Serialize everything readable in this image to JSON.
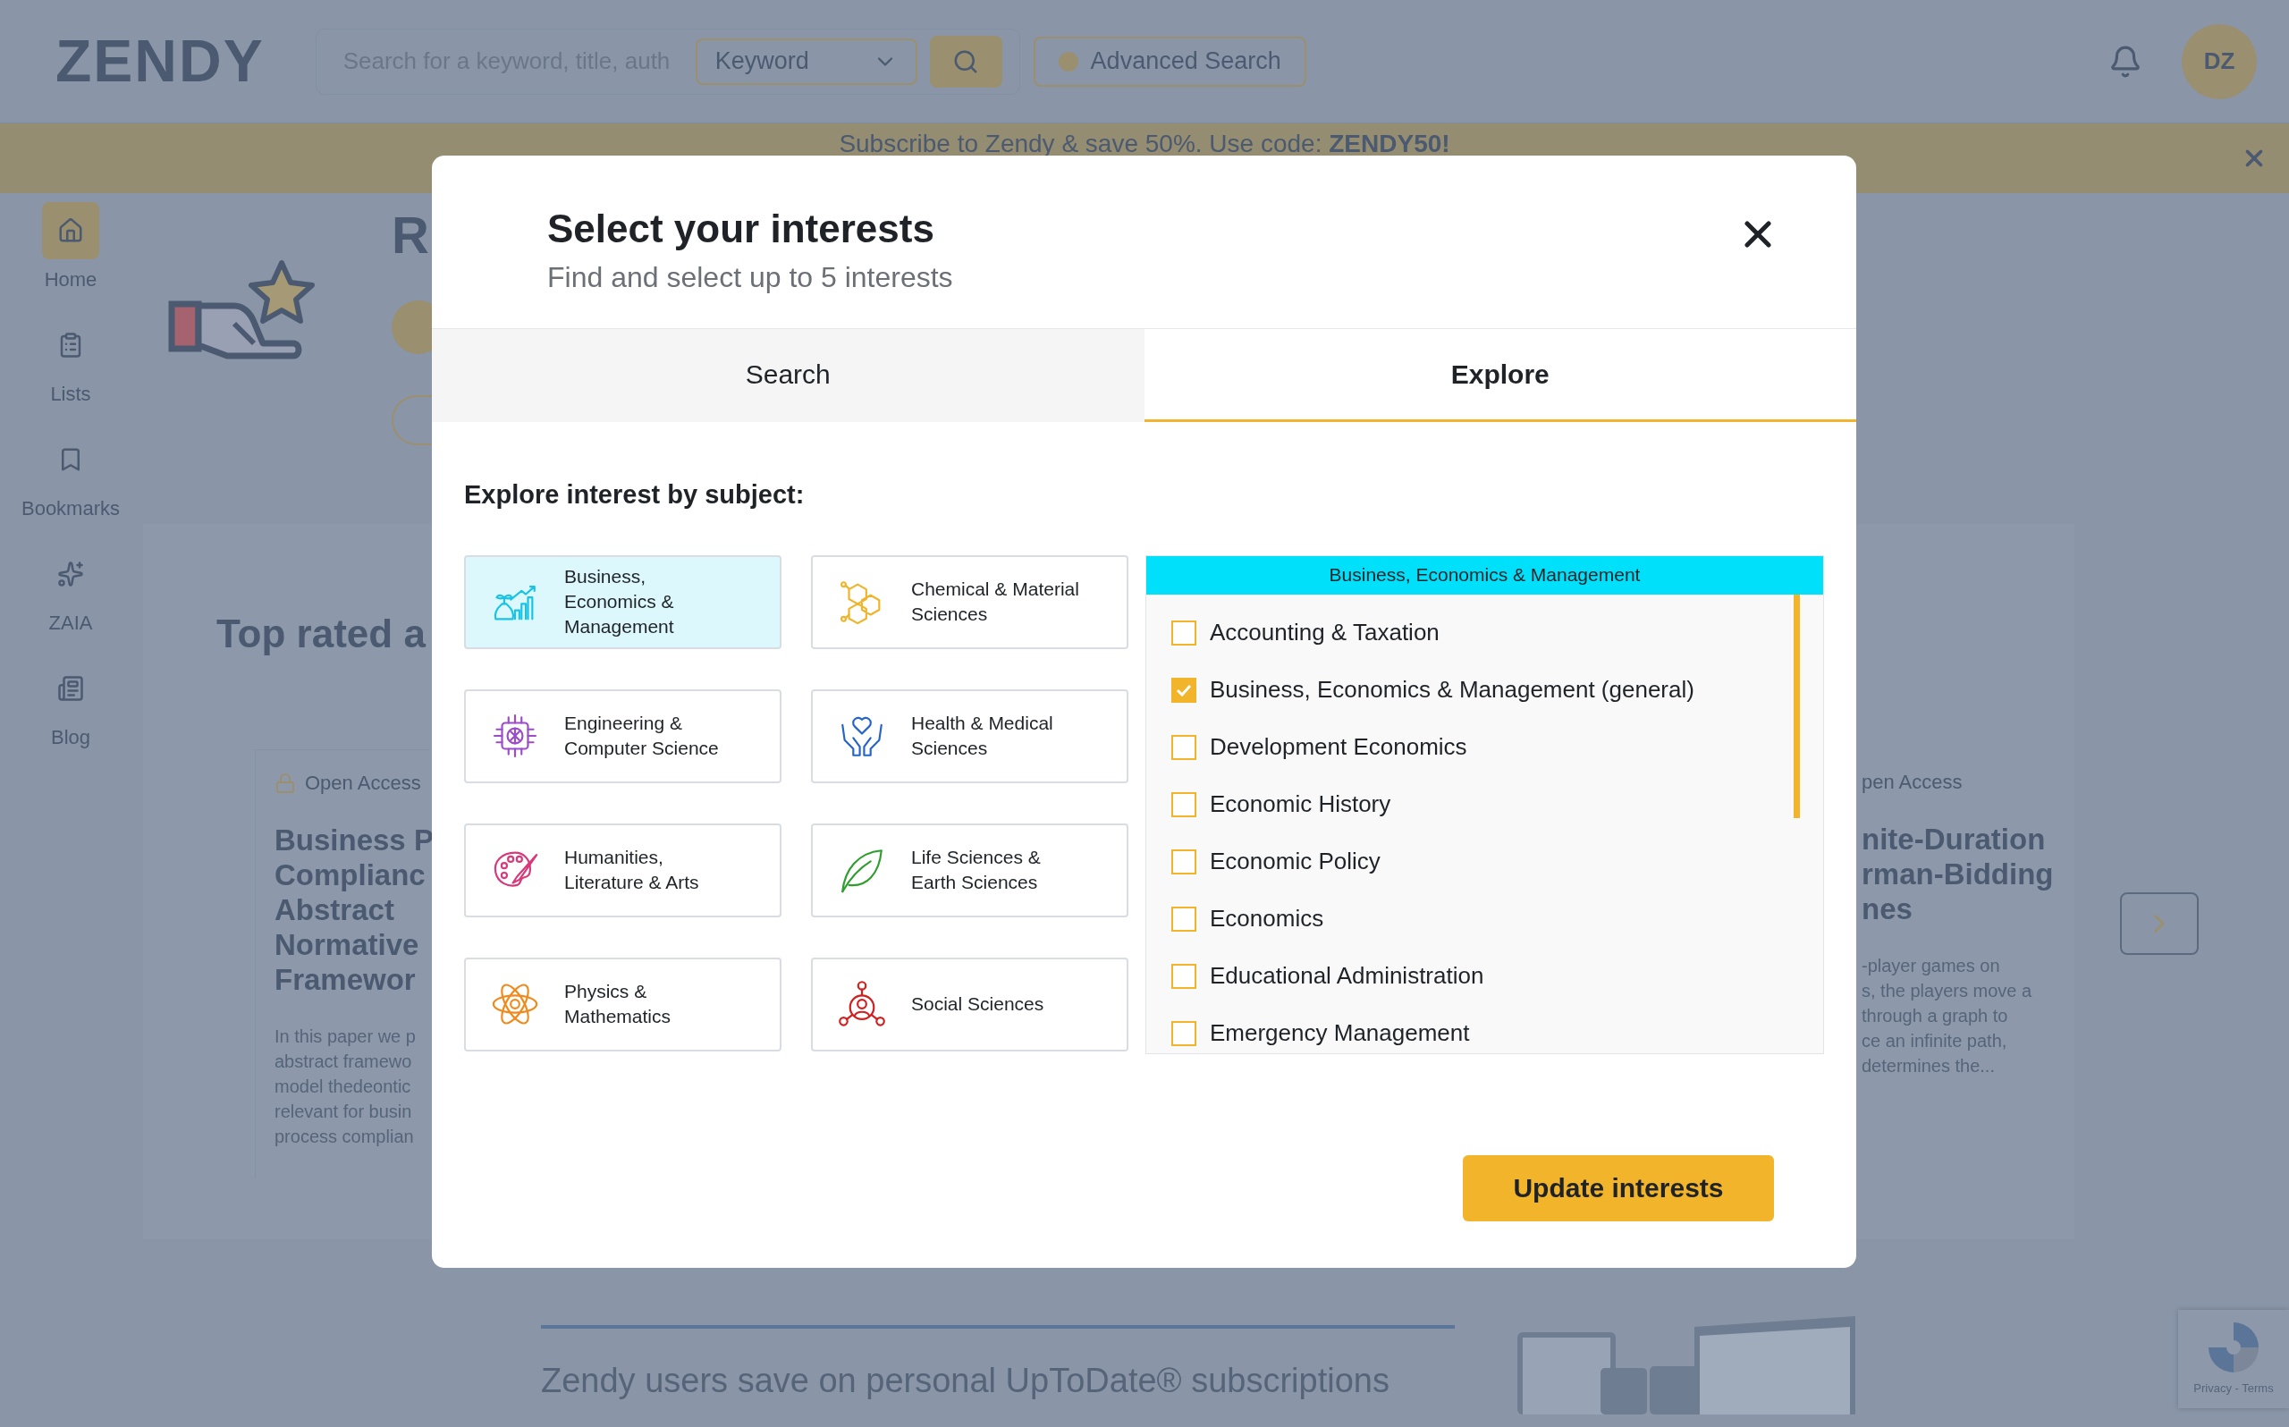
{
  "header": {
    "logo": "ZENDY",
    "search": {
      "placeholder": "Search for a keyword, title, auth"
    },
    "search_type": "Keyword",
    "advanced_search": "Advanced Search",
    "avatar": "DZ"
  },
  "banner": {
    "text": "Subscribe to Zendy & save 50%. Use code: **ZENDY50!**"
  },
  "sidebar": [
    {
      "label": "Home",
      "selected": true
    },
    {
      "label": "Lists",
      "selected": false
    },
    {
      "label": "Bookmarks",
      "selected": false
    },
    {
      "label": "ZAIA",
      "selected": false
    },
    {
      "label": "Blog",
      "selected": false
    }
  ],
  "page": {
    "heading": "R",
    "section_title": "Top rated a",
    "cards": [
      {
        "badge": "Open Access",
        "title_lines": [
          "Business P",
          "Complianc",
          "Abstract",
          "Normative",
          "Framewor"
        ],
        "abstract_lines": [
          "In this paper we p",
          "abstract framewo",
          "model thedeontic",
          "relevant for busin",
          "process complian"
        ]
      },
      {
        "badge": "pen Access",
        "title_lines": [
          "nite-Duration",
          "rman-Bidding",
          "nes"
        ],
        "abstract_lines": [
          "-player games on",
          "s, the players move a",
          "through a graph to",
          "ce an infinite path,",
          "determines the..."
        ]
      }
    ]
  },
  "promo": {
    "text": "Zendy users save on personal UpToDate® subscriptions"
  },
  "recaptcha": {
    "links": "Privacy - Terms"
  },
  "modal": {
    "title": "Select your interests",
    "subtitle": "Find and select up to 5 interests",
    "tabs": [
      {
        "label": "Search",
        "selected": false
      },
      {
        "label": "Explore",
        "selected": true
      }
    ],
    "prompt": "Explore interest by subject:",
    "subjects": [
      {
        "label_lines": [
          "Business,",
          "Economics &",
          "Management"
        ],
        "selected": true
      },
      {
        "label_lines": [
          "Chemical & Material",
          "Sciences"
        ],
        "selected": false
      },
      {
        "label_lines": [
          "Engineering &",
          "Computer Science"
        ],
        "selected": false
      },
      {
        "label_lines": [
          "Health & Medical",
          "Sciences"
        ],
        "selected": false
      },
      {
        "label_lines": [
          "Humanities,",
          "Literature & Arts"
        ],
        "selected": false
      },
      {
        "label_lines": [
          "Life Sciences &",
          "Earth Sciences"
        ],
        "selected": false
      },
      {
        "label_lines": [
          "Physics &",
          "Mathematics"
        ],
        "selected": false
      },
      {
        "label_lines": [
          "Social Sciences"
        ],
        "selected": false
      }
    ],
    "subject_panel": {
      "title": "Business, Economics & Management",
      "options": [
        {
          "label": "Accounting & Taxation",
          "checked": false
        },
        {
          "label": "Business, Economics & Management (general)",
          "checked": true
        },
        {
          "label": "Development Economics",
          "checked": false
        },
        {
          "label": "Economic History",
          "checked": false
        },
        {
          "label": "Economic Policy",
          "checked": false
        },
        {
          "label": "Economics",
          "checked": false
        },
        {
          "label": "Educational Administration",
          "checked": false
        },
        {
          "label": "Emergency Management",
          "checked": false
        }
      ]
    },
    "submit": "Update interests"
  }
}
